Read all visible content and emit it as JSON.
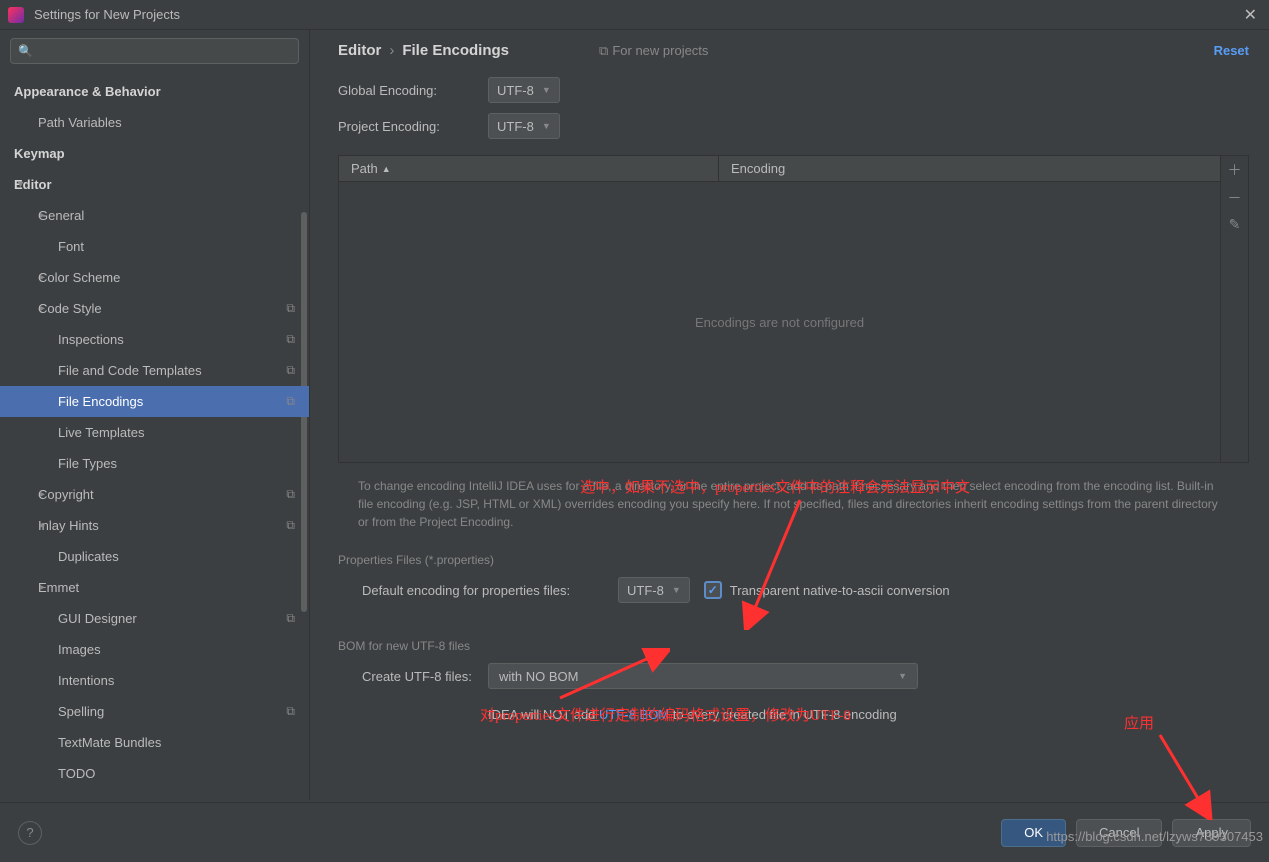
{
  "window": {
    "title": "Settings for New Projects"
  },
  "sidebar": {
    "search_placeholder": "",
    "items": [
      {
        "label": "Appearance & Behavior",
        "bold": true,
        "level": 0,
        "arrow": ""
      },
      {
        "label": "Path Variables",
        "level": 1
      },
      {
        "label": "Keymap",
        "bold": true,
        "level": 0
      },
      {
        "label": "Editor",
        "bold": true,
        "level": 0,
        "arrow": "▾"
      },
      {
        "label": "General",
        "level": 1,
        "arrow": "▸"
      },
      {
        "label": "Font",
        "level": 2
      },
      {
        "label": "Color Scheme",
        "level": 1,
        "arrow": "▸"
      },
      {
        "label": "Code Style",
        "level": 1,
        "arrow": "▸",
        "badge": "⧉"
      },
      {
        "label": "Inspections",
        "level": 2,
        "badge": "⧉"
      },
      {
        "label": "File and Code Templates",
        "level": 2,
        "badge": "⧉"
      },
      {
        "label": "File Encodings",
        "level": 2,
        "badge": "⧉",
        "selected": true
      },
      {
        "label": "Live Templates",
        "level": 2
      },
      {
        "label": "File Types",
        "level": 2
      },
      {
        "label": "Copyright",
        "level": 1,
        "arrow": "▸",
        "badge": "⧉"
      },
      {
        "label": "Inlay Hints",
        "level": 1,
        "arrow": "▸",
        "badge": "⧉"
      },
      {
        "label": "Duplicates",
        "level": 2
      },
      {
        "label": "Emmet",
        "level": 1,
        "arrow": "▸"
      },
      {
        "label": "GUI Designer",
        "level": 2,
        "badge": "⧉"
      },
      {
        "label": "Images",
        "level": 2
      },
      {
        "label": "Intentions",
        "level": 2
      },
      {
        "label": "Spelling",
        "level": 2,
        "badge": "⧉"
      },
      {
        "label": "TextMate Bundles",
        "level": 2
      },
      {
        "label": "TODO",
        "level": 2
      }
    ]
  },
  "breadcrumb": {
    "parent": "Editor",
    "current": "File Encodings"
  },
  "for_new_label": "For new projects",
  "reset_label": "Reset",
  "global_encoding": {
    "label": "Global Encoding:",
    "value": "UTF-8"
  },
  "project_encoding": {
    "label": "Project Encoding:",
    "value": "UTF-8"
  },
  "table": {
    "col_path": "Path",
    "col_encoding": "Encoding",
    "empty_text": "Encodings are not configured"
  },
  "help_text": "To change encoding IntelliJ IDEA uses for a file, a directory, or the entire project, add its path if necessary and then select encoding from the encoding list. Built-in file encoding (e.g. JSP, HTML or XML) overrides encoding you specify here. If not specified, files and directories inherit encoding settings from the parent directory or from the Project Encoding.",
  "properties_section": {
    "title": "Properties Files (*.properties)",
    "default_label": "Default encoding for properties files:",
    "default_value": "UTF-8",
    "checkbox_label": "Transparent native-to-ascii conversion"
  },
  "bom_section": {
    "title": "BOM for new UTF-8 files",
    "create_label": "Create UTF-8 files:",
    "create_value": "with NO BOM",
    "info_prefix": "IDEA will NOT add ",
    "info_link": "UTF-8 BOM",
    "info_suffix": " to every created file in UTF-8 encoding"
  },
  "buttons": {
    "ok": "OK",
    "cancel": "Cancel",
    "apply": "Apply"
  },
  "annotations": {
    "a1": "选中，如果不选中，properties文件中的注释会无法显示中文",
    "a2": "对properties文件进行定制的编码格式设置，修改为UTF-8",
    "a3": "应用"
  },
  "watermark": "https://blog.csdn.net/lzyws739307453"
}
